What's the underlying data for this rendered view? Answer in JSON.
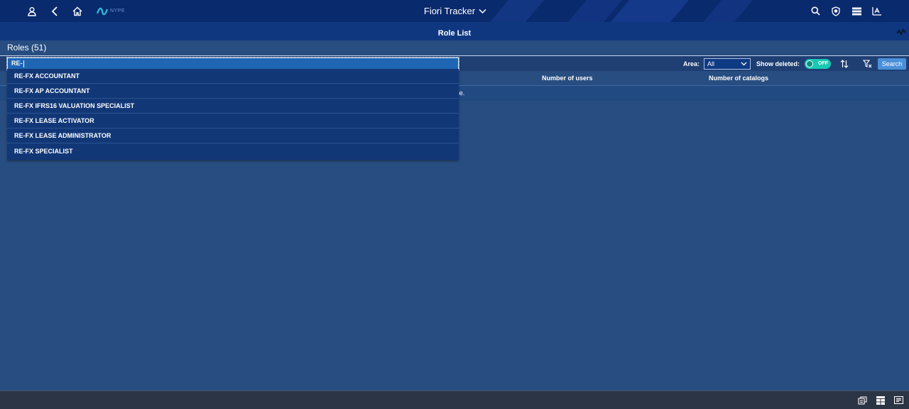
{
  "shell": {
    "logo_text": "NYPE",
    "app_title": "Fiori Tracker",
    "colors": {
      "shellbar": "#0a2a6e",
      "background": "#284d80"
    },
    "icons_left": [
      "user-icon",
      "back-icon",
      "home-icon"
    ],
    "icons_right": [
      "search-icon",
      "notifications-icon",
      "menu-icon",
      "text-direction-icon"
    ]
  },
  "page": {
    "title": "Role List",
    "roles_count_label": "Roles (51)"
  },
  "search": {
    "value": "RE-"
  },
  "filters": {
    "area_label": "Area:",
    "area_value": "All",
    "show_deleted_label": "Show deleted:",
    "toggle_label": "OFF",
    "search_button_label": "Search"
  },
  "table": {
    "columns": [
      "Number of users",
      "Number of catalogs"
    ],
    "no_data_text": "ailable."
  },
  "suggestions": [
    "RE-FX ACCOUNTANT",
    "RE-FX AP ACCOUNTANT",
    "RE-FX IFRS16 VALUATION SPECIALIST",
    "RE-FX LEASE ACTIVATOR",
    "RE-FX LEASE ADMINISTRATOR",
    "RE-FX SPECIALIST"
  ],
  "footer": {
    "icons": [
      "export-icon",
      "grid-icon",
      "list-icon"
    ]
  }
}
